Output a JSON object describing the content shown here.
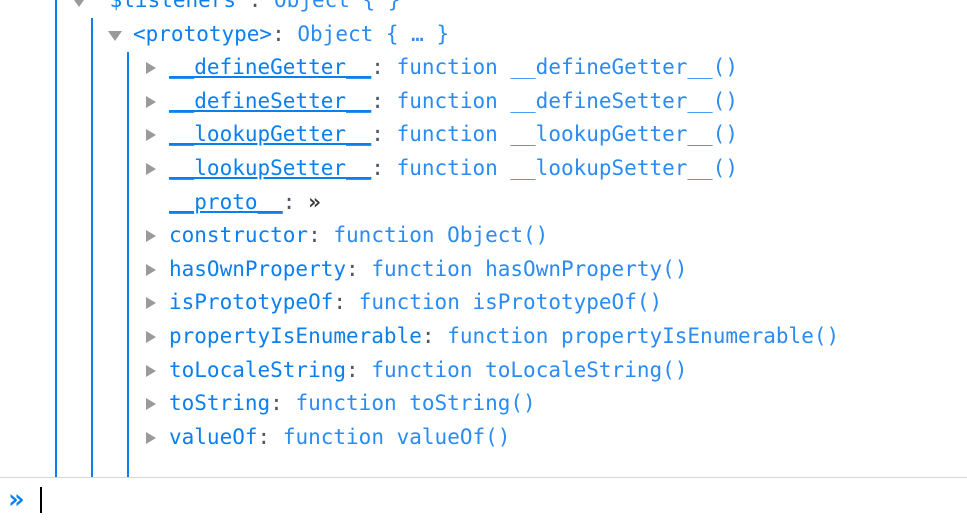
{
  "panel": {
    "name": "object-inspector",
    "theme": "firefox-devtools-light",
    "colors": {
      "key": "#0b7fee",
      "value": "#2a8bf2",
      "guide_line": "#0b7fee",
      "twisty": "#9a9a9a",
      "divider": "#d7d7db",
      "background": "#ffffff",
      "prompt": "#0b7fee"
    }
  },
  "tree": {
    "rows": [
      {
        "indent": 1,
        "twisty": "expanded",
        "key": "\"$listeners\"",
        "key_interesting": false,
        "separator": ":",
        "value": "Object {  }"
      },
      {
        "indent": 2,
        "twisty": "expanded",
        "key": "<prototype>",
        "key_interesting": false,
        "separator": ":",
        "value": "Object { … }"
      },
      {
        "indent": 3,
        "twisty": "collapsed",
        "key": "__defineGetter__",
        "key_interesting": true,
        "separator": ":",
        "value": "function __defineGetter__()"
      },
      {
        "indent": 3,
        "twisty": "collapsed",
        "key": "__defineSetter__",
        "key_interesting": true,
        "separator": ":",
        "value": "function __defineSetter__()"
      },
      {
        "indent": 3,
        "twisty": "collapsed",
        "key": "__lookupGetter__",
        "key_interesting": true,
        "separator": ":",
        "value": "function __lookupGetter__()"
      },
      {
        "indent": 3,
        "twisty": "collapsed",
        "key": "__lookupSetter__",
        "key_interesting": true,
        "separator": ":",
        "value": "function __lookupSetter__()"
      },
      {
        "indent": 3,
        "twisty": "none",
        "key": "__proto__",
        "key_interesting": true,
        "separator": ":",
        "value": "»",
        "value_kind": "more"
      },
      {
        "indent": 3,
        "twisty": "collapsed",
        "key": "constructor",
        "key_interesting": false,
        "separator": ":",
        "value": "function Object()"
      },
      {
        "indent": 3,
        "twisty": "collapsed",
        "key": "hasOwnProperty",
        "key_interesting": false,
        "separator": ":",
        "value": "function hasOwnProperty()"
      },
      {
        "indent": 3,
        "twisty": "collapsed",
        "key": "isPrototypeOf",
        "key_interesting": false,
        "separator": ":",
        "value": "function isPrototypeOf()"
      },
      {
        "indent": 3,
        "twisty": "collapsed",
        "key": "propertyIsEnumerable",
        "key_interesting": false,
        "separator": ":",
        "value": "function propertyIsEnumerable()"
      },
      {
        "indent": 3,
        "twisty": "collapsed",
        "key": "toLocaleString",
        "key_interesting": false,
        "separator": ":",
        "value": "function toLocaleString()"
      },
      {
        "indent": 3,
        "twisty": "collapsed",
        "key": "toString",
        "key_interesting": false,
        "separator": ":",
        "value": "function toString()"
      },
      {
        "indent": 3,
        "twisty": "collapsed",
        "key": "valueOf",
        "key_interesting": false,
        "separator": ":",
        "value": "function valueOf()"
      }
    ]
  },
  "console": {
    "prompt_symbol": "»",
    "input_value": "",
    "placeholder": ""
  }
}
